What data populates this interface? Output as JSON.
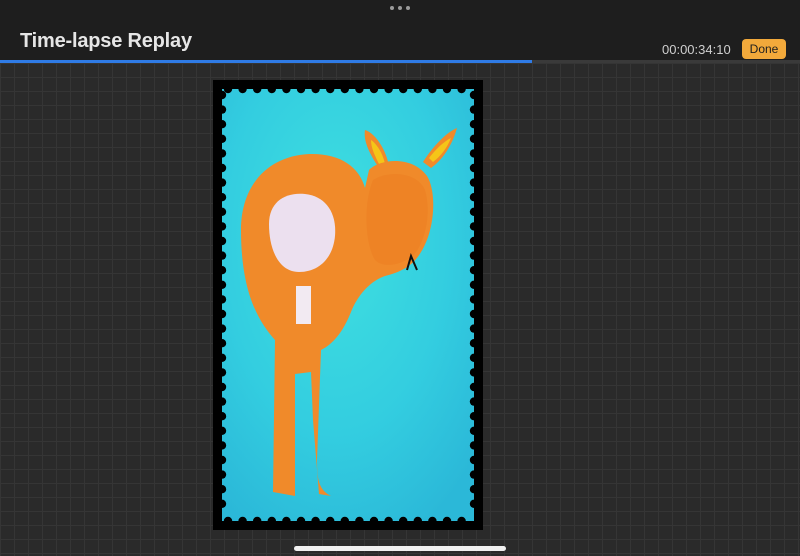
{
  "header": {
    "title": "Time-lapse Replay",
    "timestamp": "00:00:34:10",
    "done_label": "Done"
  },
  "playback": {
    "progress_fraction": 0.665
  },
  "icons": {
    "more": "more-horizontal-icon"
  },
  "colors": {
    "accent": "#2f7be6",
    "done_button": "#f2a93b",
    "stamp_background": "#3cd2dc",
    "deer_body": "#f08a2a",
    "tail_patch": "#ece0ef"
  }
}
